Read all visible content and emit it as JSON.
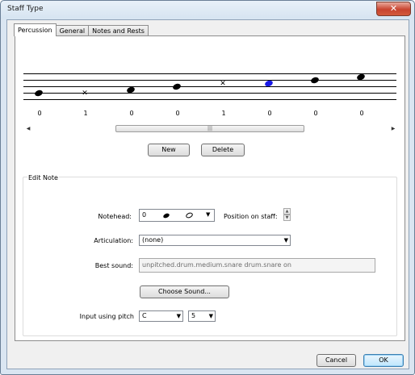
{
  "window": {
    "title": "Staff Type",
    "close_glyph": "✕"
  },
  "tabs": [
    {
      "label": "Percussion",
      "active": true
    },
    {
      "label": "General",
      "active": false
    },
    {
      "label": "Notes and Rests",
      "active": false
    }
  ],
  "staff": {
    "notes": [
      {
        "kind": "solid",
        "label": "0"
      },
      {
        "kind": "cross",
        "label": "1"
      },
      {
        "kind": "solid",
        "label": "0"
      },
      {
        "kind": "solid",
        "label": "0"
      },
      {
        "kind": "cross",
        "label": "1"
      },
      {
        "kind": "solid-selected",
        "label": "0"
      },
      {
        "kind": "solid",
        "label": "0"
      },
      {
        "kind": "solid",
        "label": "0"
      }
    ],
    "selected_color": "#1a1ae6"
  },
  "scrollbar": {
    "left_arrow": "◀",
    "right_arrow": "▶",
    "thumb_grip": "|||"
  },
  "buttons": {
    "new": "New",
    "delete": "Delete",
    "choose_sound": "Choose Sound...",
    "cancel": "Cancel",
    "ok": "OK"
  },
  "edit_note": {
    "title": "Edit Note",
    "notehead_label": "Notehead:",
    "notehead_value": "0",
    "position_label": "Position on staff:",
    "articulation_label": "Articulation:",
    "articulation_value": "(none)",
    "best_sound_label": "Best sound:",
    "best_sound_value": "unpitched.drum.medium.snare drum.snare on",
    "input_pitch_label": "Input using pitch",
    "pitch_value": "C",
    "octave_value": "5"
  },
  "icons": {
    "dropdown": "▼",
    "spin_up": "▲",
    "spin_down": "▼"
  }
}
